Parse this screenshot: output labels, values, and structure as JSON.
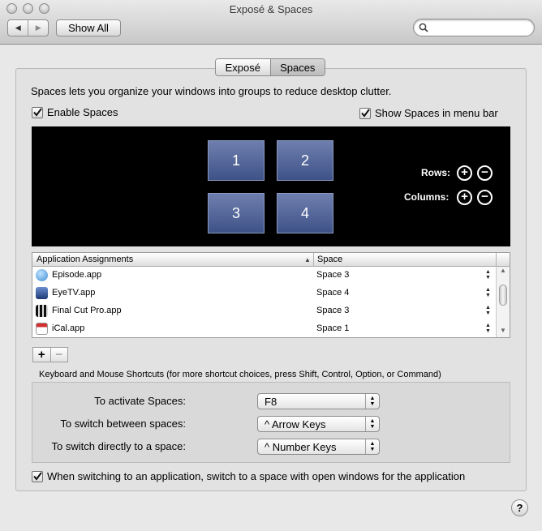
{
  "window": {
    "title": "Exposé & Spaces"
  },
  "toolbar": {
    "show_all": "Show All",
    "search_placeholder": ""
  },
  "tabs": [
    {
      "label": "Exposé"
    },
    {
      "label": "Spaces",
      "selected": true
    }
  ],
  "spaces": {
    "description": "Spaces lets you organize your windows into groups to reduce desktop clutter.",
    "enable_label": "Enable Spaces",
    "enable_checked": true,
    "menu_bar_label": "Show Spaces in menu bar",
    "menu_bar_checked": true,
    "grid": [
      "1",
      "2",
      "3",
      "4"
    ],
    "rows_label": "Rows:",
    "columns_label": "Columns:"
  },
  "table": {
    "headers": [
      "Application Assignments",
      "Space"
    ],
    "rows": [
      {
        "app": "Episode.app",
        "space": "Space 3",
        "icon": "episode-icon",
        "color": "#4a90d9"
      },
      {
        "app": "EyeTV.app",
        "space": "Space 4",
        "icon": "eyetv-icon",
        "color": "#2f4c8c"
      },
      {
        "app": "Final Cut Pro.app",
        "space": "Space 3",
        "icon": "final-cut-pro-icon",
        "color": "#222222"
      },
      {
        "app": "iCal.app",
        "space": "Space 1",
        "icon": "ical-icon",
        "color": "#c62828"
      }
    ]
  },
  "shortcuts": {
    "title": "Keyboard and Mouse Shortcuts (for more shortcut choices, press Shift, Control, Option, or Command)",
    "items": [
      {
        "label": "To activate Spaces:",
        "value": "F8"
      },
      {
        "label": "To switch between spaces:",
        "value": "^ Arrow Keys"
      },
      {
        "label": "To switch directly to a space:",
        "value": "^ Number Keys"
      }
    ]
  },
  "switch_option": {
    "label": "When switching to an application, switch to a space with open windows for the application",
    "checked": true
  },
  "help": "?"
}
